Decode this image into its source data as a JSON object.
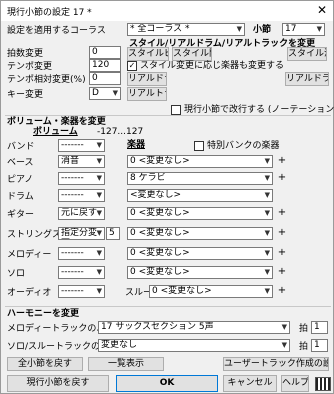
{
  "window": {
    "title": "現行小節の設定 17 *",
    "close_glyph": "✕"
  },
  "top": {
    "apply_label": "設定を適用するコーラス",
    "chorus_value": "* 全コーラス *",
    "bar_label": "小節",
    "bar_value": "17",
    "style_header": "スタイル/リアルドラム/リアルトラックを変更",
    "btn_style_pick": "スタイルピック",
    "btn_style_open": "スタイル開く",
    "btn_style_clear": "スタイル消",
    "time_sig_label": "拍数変更",
    "time_sig_value": "0",
    "tempo_label": "テンポ変更",
    "tempo_value": "120",
    "tempo_rel_label": "テンポ相対変更(%)",
    "tempo_rel_value": "0",
    "key_label": "キー変更",
    "key_value": "D",
    "style_instr_label": "スタイル変更に応じ楽器も変更する",
    "btn_realdrum": "リアルドラム",
    "btn_realdrum_clear": "リアルドラム消",
    "btn_realtrack": "リアルトラック",
    "newline_label": "現行小節で改行する (ノーテーション)"
  },
  "volume": {
    "header": "ボリューム・楽器を変更",
    "vol_header": "ボリューム",
    "vol_range": "-127...127",
    "instr_header": "楽器",
    "special_bank_label": "特別バンクの楽器",
    "rows": [
      {
        "label": "バンド",
        "vol": "-------",
        "instr": ""
      },
      {
        "label": "ベース",
        "vol": "消音",
        "instr": "0 <変更なし>"
      },
      {
        "label": "ピアノ",
        "vol": "-------",
        "instr": "8 ケラビ"
      },
      {
        "label": "ドラム",
        "vol": "-------",
        "instr": "<変更なし>"
      },
      {
        "label": "ギター",
        "vol": "元に戻す",
        "instr": "0 <変更なし>"
      },
      {
        "label": "ストリングス",
        "vol": "指定分変更",
        "amount": "5",
        "instr": "0 <変更なし>"
      },
      {
        "label": "メロディー",
        "vol": "-------",
        "instr": "0 <変更なし>"
      },
      {
        "label": "ソロ",
        "vol": "-------",
        "instr": "0 <変更なし>"
      },
      {
        "label": "オーディオ",
        "vol": "-------",
        "instr": "0 <変更なし>"
      }
    ],
    "through_label": "スルー"
  },
  "harmony": {
    "header": "ハーモニーを変更",
    "melody_label": "メロディートラックのハーモニー",
    "melody_value": "17 サックスセクション 5声",
    "solo_label": "ソロ/スルートラックのハーモニー",
    "solo_value": "変更なし",
    "beat_label": "拍",
    "beat1_value": "1",
    "beat2_value": "1"
  },
  "buttons": {
    "all_bars_reset": "全小節を戻す",
    "list_view": "一覧表示",
    "user_track_settings": "ユーザートラック作成の設定",
    "current_bar_reset": "現行小節を戻す",
    "ok": "OK",
    "cancel": "キャンセル",
    "help": "ヘルプ"
  }
}
